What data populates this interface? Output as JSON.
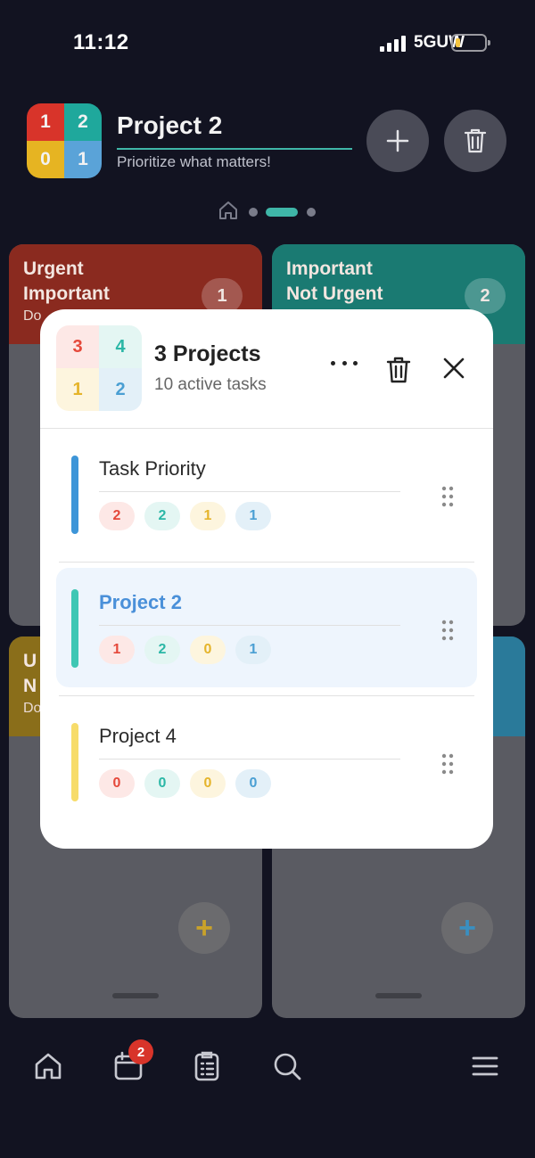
{
  "status": {
    "time": "11:12",
    "network": "5GUW"
  },
  "header": {
    "title": "Project 2",
    "subtitle": "Prioritize what matters!",
    "logo_counts": [
      "1",
      "2",
      "0",
      "1"
    ]
  },
  "quadrants": [
    {
      "title_line1": "Urgent",
      "title_line2": "Important",
      "sub": "Do",
      "count": "1"
    },
    {
      "title_line1": "Important",
      "title_line2": "Not Urgent",
      "sub": "",
      "count": "2"
    },
    {
      "title_line1": "U",
      "title_line2": "N",
      "sub": "Do",
      "count": ""
    },
    {
      "title_line1": "",
      "title_line2": "",
      "sub": "",
      "count": ""
    }
  ],
  "bottom_nav": {
    "calendar_badge": "2"
  },
  "modal": {
    "title": "3 Projects",
    "subtitle": "10 active tasks",
    "logo_counts": [
      "3",
      "4",
      "1",
      "2"
    ],
    "projects": [
      {
        "name": "Task Priority",
        "color": "#3d95d8",
        "counts": [
          "2",
          "2",
          "1",
          "1"
        ]
      },
      {
        "name": "Project 2",
        "color": "#3fc7b4",
        "counts": [
          "1",
          "2",
          "0",
          "1"
        ]
      },
      {
        "name": "Project 4",
        "color": "#f7dc6a",
        "counts": [
          "0",
          "0",
          "0",
          "0"
        ]
      }
    ]
  },
  "colors": {
    "urgent_important": "#d8342a",
    "important_not_urgent": "#1fa89c",
    "urgent_not_important": "#e6b422",
    "not_urgent_not_important": "#5aa3d8"
  }
}
